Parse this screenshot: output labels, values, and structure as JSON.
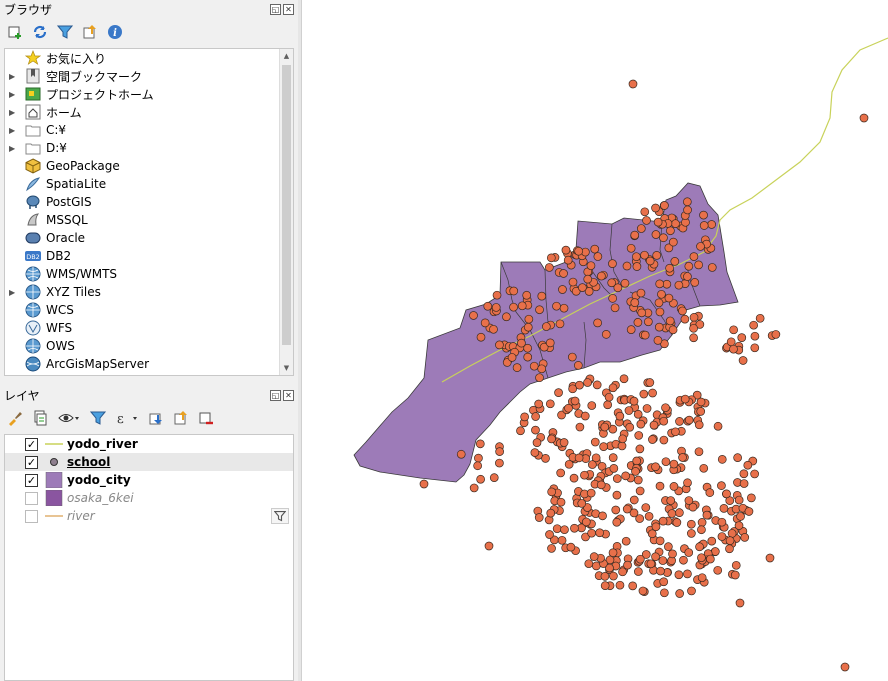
{
  "browser": {
    "title": "ブラウザ",
    "items": [
      {
        "label": "お気に入り",
        "icon": "star-icon",
        "expandable": false
      },
      {
        "label": "空間ブックマーク",
        "icon": "bookmark-icon",
        "expandable": true
      },
      {
        "label": "プロジェクトホーム",
        "icon": "project-home-icon",
        "expandable": true
      },
      {
        "label": "ホーム",
        "icon": "home-icon",
        "expandable": true
      },
      {
        "label": "C:¥",
        "icon": "folder-icon",
        "expandable": true
      },
      {
        "label": "D:¥",
        "icon": "folder-icon",
        "expandable": true
      },
      {
        "label": "GeoPackage",
        "icon": "geopackage-icon",
        "expandable": false
      },
      {
        "label": "SpatiaLite",
        "icon": "spatialite-icon",
        "expandable": false
      },
      {
        "label": "PostGIS",
        "icon": "postgis-icon",
        "expandable": false
      },
      {
        "label": "MSSQL",
        "icon": "mssql-icon",
        "expandable": false
      },
      {
        "label": "Oracle",
        "icon": "oracle-icon",
        "expandable": false
      },
      {
        "label": "DB2",
        "icon": "db2-icon",
        "expandable": false
      },
      {
        "label": "WMS/WMTS",
        "icon": "wms-icon",
        "expandable": false
      },
      {
        "label": "XYZ Tiles",
        "icon": "xyz-tiles-icon",
        "expandable": true
      },
      {
        "label": "WCS",
        "icon": "wcs-icon",
        "expandable": false
      },
      {
        "label": "WFS",
        "icon": "wfs-icon",
        "expandable": false
      },
      {
        "label": "OWS",
        "icon": "ows-icon",
        "expandable": false
      },
      {
        "label": "ArcGisMapServer",
        "icon": "arcgis-icon",
        "expandable": false
      }
    ]
  },
  "layers": {
    "title": "レイヤ",
    "items": [
      {
        "name": "yodo_river",
        "checked": true,
        "symbol": "line",
        "color": "#c8d25a",
        "selected": false,
        "active": true
      },
      {
        "name": "school",
        "checked": true,
        "symbol": "point",
        "color": "#8e7f8e",
        "selected": true,
        "active": true
      },
      {
        "name": "yodo_city",
        "checked": true,
        "symbol": "polygon",
        "color": "#9d7bb8",
        "selected": false,
        "active": true
      },
      {
        "name": "osaka_6kei",
        "checked": false,
        "symbol": "polygon",
        "color": "#8a55a0",
        "selected": false,
        "active": false
      },
      {
        "name": "river",
        "checked": false,
        "symbol": "line",
        "color": "#e0b070",
        "selected": false,
        "active": false
      }
    ]
  },
  "map": {
    "polygon_fill": "#9d7bb8",
    "polygon_stroke": "#3a3a3a",
    "point_fill": "#e8704a",
    "point_stroke": "#3a2a20",
    "river_color": "#c8d25a"
  }
}
